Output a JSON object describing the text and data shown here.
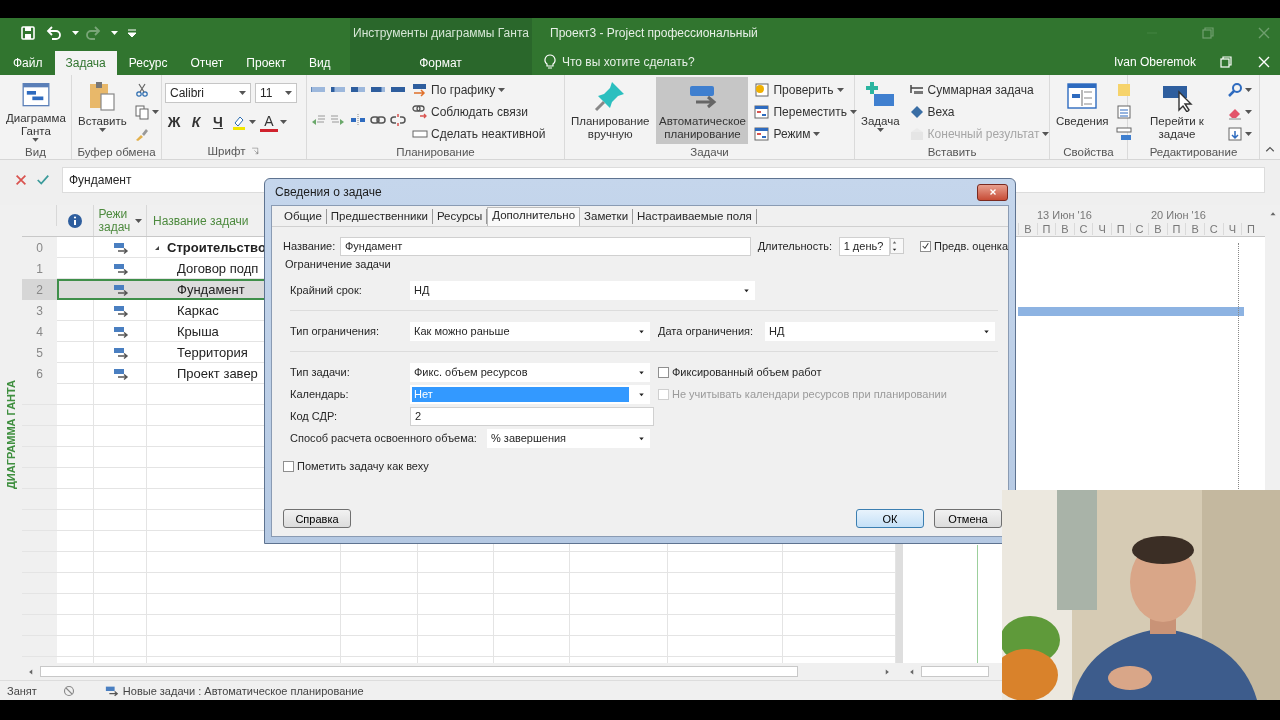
{
  "quick_access": [
    {
      "kind": "save",
      "disabled": false
    },
    {
      "kind": "undo",
      "disabled": false
    },
    {
      "kind": "redo",
      "disabled": true
    },
    {
      "kind": "customize",
      "disabled": false
    }
  ],
  "window": {
    "context_group": "Инструменты диаграммы Ганта",
    "title": "Проект3 - Project профессиональный",
    "user": "Ivan Oberemok"
  },
  "ribbon_tabs": [
    {
      "label": "Файл",
      "selected": false
    },
    {
      "label": "Задача",
      "selected": true
    },
    {
      "label": "Ресурс",
      "selected": false
    },
    {
      "label": "Отчет",
      "selected": false
    },
    {
      "label": "Проект",
      "selected": false
    },
    {
      "label": "Вид",
      "selected": false
    }
  ],
  "context_tabs": [
    {
      "label": "Формат",
      "selected": false
    }
  ],
  "tell_me": {
    "placeholder": "Что вы хотите сделать?"
  },
  "ribbon_groups": [
    {
      "label": "Вид",
      "columns": [
        [
          [
            {
              "kind": "large",
              "label": "Диаграмма Ганта",
              "dropdown": true
            }
          ]
        ]
      ]
    },
    {
      "label": "Буфер обмена",
      "columns": [
        [
          [
            {
              "kind": "large",
              "label": "Вставить",
              "dropdown": true
            }
          ]
        ],
        [
          [
            {
              "kind": "icon"
            }
          ],
          [
            {
              "kind": "icon",
              "dropdown": true
            }
          ],
          [
            {
              "kind": "icon"
            }
          ]
        ]
      ]
    },
    {
      "label": "Шрифт",
      "launcher": true,
      "columns": [
        [
          [
            {
              "kind": "select",
              "value": "Calibri"
            },
            {
              "kind": "select",
              "value": "11"
            }
          ],
          [
            {
              "kind": "bold",
              "label": "Ж"
            },
            {
              "kind": "italic",
              "label": "К"
            },
            {
              "kind": "underline",
              "label": "Ч"
            },
            {
              "kind": "icon",
              "dropdown": true
            },
            {
              "kind": "color",
              "label": "А",
              "dropdown": true
            }
          ]
        ]
      ]
    },
    {
      "label": "Планирование",
      "columns": [
        [
          [
            {
              "kind": "percent"
            },
            {
              "kind": "percent"
            },
            {
              "kind": "percent"
            },
            {
              "kind": "percent"
            },
            {
              "kind": "percent"
            }
          ],
          [
            {
              "kind": "icon"
            },
            {
              "kind": "icon"
            },
            {
              "kind": "icon"
            },
            {
              "kind": "icon"
            },
            {
              "kind": "icon"
            }
          ]
        ],
        [
          [
            {
              "kind": "small",
              "label": "По графику",
              "dropdown": true
            }
          ],
          [
            {
              "kind": "small",
              "label": "Соблюдать связи"
            }
          ],
          [
            {
              "kind": "small",
              "label": "Сделать неактивной"
            }
          ]
        ]
      ]
    },
    {
      "label": "Задачи",
      "columns": [
        [
          [
            {
              "kind": "large",
              "label": "Планирование вручную",
              "selected": false
            }
          ]
        ],
        [
          [
            {
              "kind": "large",
              "label": "Автоматическое планирование",
              "selected": true
            }
          ]
        ],
        [
          [
            {
              "kind": "small",
              "label": "Проверить",
              "dropdown": true
            }
          ],
          [
            {
              "kind": "small",
              "label": "Переместить",
              "dropdown": true
            }
          ],
          [
            {
              "kind": "small",
              "label": "Режим",
              "dropdown": true
            }
          ]
        ]
      ]
    },
    {
      "label": "Вставить",
      "columns": [
        [
          [
            {
              "kind": "large",
              "label": "Задача",
              "dropdown": true
            }
          ]
        ],
        [
          [
            {
              "kind": "small",
              "label": "Суммарная задача",
              "disabled": false
            }
          ],
          [
            {
              "kind": "small",
              "label": "Веха",
              "disabled": false
            }
          ],
          [
            {
              "kind": "small",
              "label": "Конечный результат",
              "dropdown": true,
              "disabled": true
            }
          ]
        ]
      ]
    },
    {
      "label": "Свойства",
      "columns": [
        [
          [
            {
              "kind": "large",
              "label": "Сведения"
            }
          ]
        ],
        [
          [
            {
              "kind": "icon"
            }
          ],
          [
            {
              "kind": "icon"
            }
          ],
          [
            {
              "kind": "icon"
            }
          ]
        ]
      ]
    },
    {
      "label": "Редактирование",
      "columns": [
        [
          [
            {
              "kind": "large",
              "label": "Перейти к задаче"
            }
          ]
        ],
        [
          [
            {
              "kind": "icon",
              "dropdown": true
            }
          ],
          [
            {
              "kind": "icon",
              "dropdown": true
            }
          ],
          [
            {
              "kind": "icon",
              "dropdown": true
            }
          ]
        ]
      ]
    }
  ],
  "formula_bar": {
    "value": "Фундамент"
  },
  "view_label": "ДИАГРАММА ГАНТА",
  "table": {
    "columns": [
      {
        "label": "Режи задач",
        "filter": true
      },
      {
        "label": "Название задачи"
      }
    ],
    "rows": [
      {
        "id": "0",
        "name": "Строительство",
        "selected": false,
        "expanded": true,
        "children": [
          {
            "id": "1",
            "name": "Договор подп",
            "selected": false
          },
          {
            "id": "2",
            "name": "Фундамент",
            "selected": true
          },
          {
            "id": "3",
            "name": "Каркас",
            "selected": false
          },
          {
            "id": "4",
            "name": "Крыша",
            "selected": false
          },
          {
            "id": "5",
            "name": "Территория",
            "selected": false
          },
          {
            "id": "6",
            "name": "Проект завер",
            "selected": false
          }
        ]
      }
    ]
  },
  "gantt": {
    "weeks": [
      {
        "label": "13 Июн '16"
      },
      {
        "label": "20 Июн '16"
      }
    ],
    "days": [
      "В",
      "П",
      "В",
      "С",
      "Ч",
      "П",
      "С",
      "В",
      "П",
      "В",
      "С",
      "Ч",
      "П"
    ]
  },
  "dialog": {
    "title": "Сведения о задаче",
    "tabs": [
      {
        "label": "Общие",
        "selected": false
      },
      {
        "label": "Предшественники",
        "selected": false
      },
      {
        "label": "Ресурсы",
        "selected": false
      },
      {
        "label": "Дополнительно",
        "selected": true
      },
      {
        "label": "Заметки",
        "selected": false
      },
      {
        "label": "Настраиваемые поля",
        "selected": false
      }
    ],
    "name": {
      "label": "Название:",
      "value": "Фундамент"
    },
    "duration": {
      "label": "Длительность:",
      "value": "1 день?"
    },
    "estimate": {
      "label": "Предв. оценка",
      "checked": true
    },
    "section": "Ограничение задачи",
    "deadline": {
      "label": "Крайний срок:",
      "value": "НД"
    },
    "constraint_type": {
      "label": "Тип ограничения:",
      "value": "Как можно раньше"
    },
    "constraint_date": {
      "label": "Дата ограничения:",
      "value": "НД"
    },
    "task_type": {
      "label": "Тип задачи:",
      "value": "Фикс. объем ресурсов"
    },
    "fixed_work": {
      "label": "Фиксированный объем работ",
      "checked": false,
      "disabled": false
    },
    "calendar": {
      "label": "Календарь:",
      "value": "Нет",
      "selected": true
    },
    "ignore_calendars": {
      "label": "Не учитывать календари ресурсов при планировании",
      "checked": false,
      "disabled": true
    },
    "wbs": {
      "label": "Код СДР:",
      "value": "2"
    },
    "earned_value": {
      "label": "Способ расчета освоенного объема:",
      "value": "% завершения"
    },
    "milestone": {
      "label": "Пометить задачу как веху",
      "checked": false
    },
    "buttons": [
      {
        "label": "Справка",
        "default": false
      },
      {
        "label": "ОК",
        "default": true
      },
      {
        "label": "Отмена",
        "default": false
      }
    ]
  },
  "status_bar": {
    "state": "Занят",
    "new_tasks": "Новые задачи : Автоматическое планирование"
  }
}
